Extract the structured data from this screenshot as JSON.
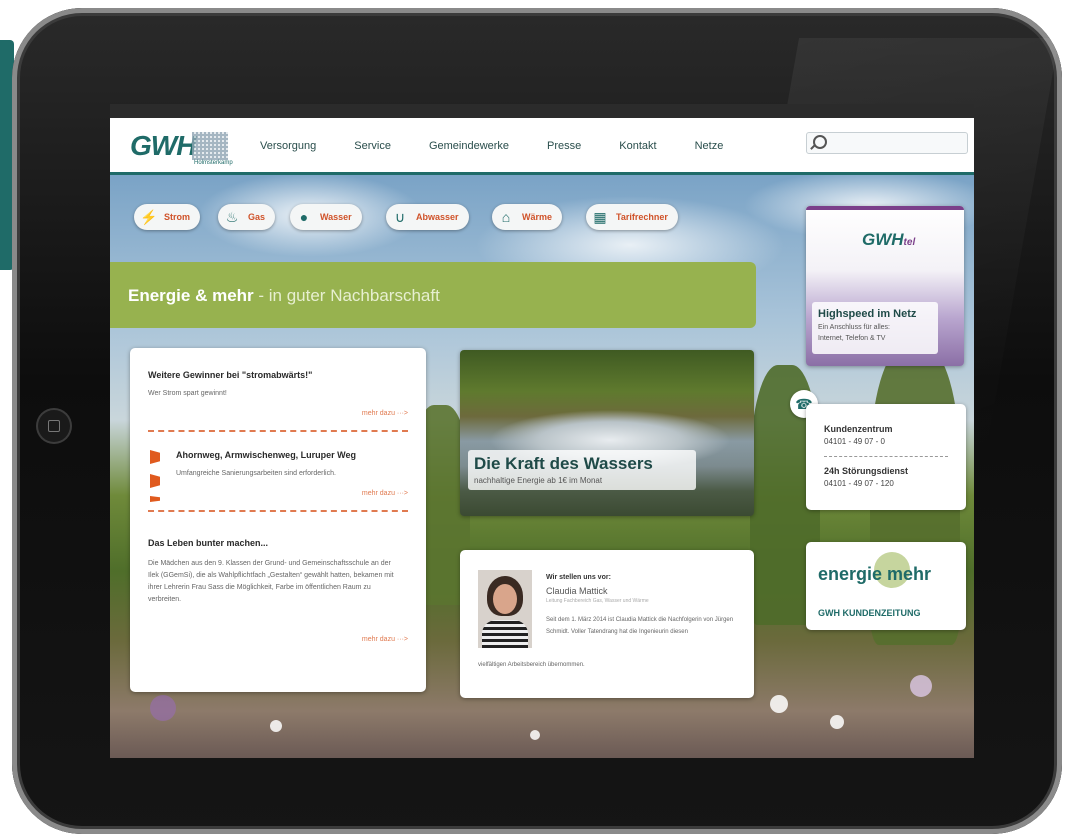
{
  "header": {
    "logo_text": "GWH",
    "logo_subtext": "Holmsterkamp",
    "nav": [
      "Versorgung",
      "Service",
      "Gemeindewerke",
      "Presse",
      "Kontakt",
      "Netze"
    ],
    "search_placeholder": ""
  },
  "categories": [
    {
      "label": "Strom",
      "icon": "plug-icon"
    },
    {
      "label": "Gas",
      "icon": "flame-icon"
    },
    {
      "label": "Wasser",
      "icon": "drop-icon"
    },
    {
      "label": "Abwasser",
      "icon": "pipe-icon"
    },
    {
      "label": "Wärme",
      "icon": "house-heat-icon"
    },
    {
      "label": "Tarifrechner",
      "icon": "calculator-icon"
    }
  ],
  "banner": {
    "title": "Energie & mehr",
    "subtitle": " - in guter Nachbarschaft"
  },
  "news": {
    "item1": {
      "title": "Weitere Gewinner bei \"stromabwärts!\"",
      "text": "Wer Strom spart gewinnt!",
      "more": "mehr dazu ···>"
    },
    "item2": {
      "title": "Ahornweg, Armwischenweg, Luruper Weg",
      "text": "Umfangreiche Sanierungsarbeiten sind erforderlich.",
      "more": "mehr dazu ···>"
    },
    "item3": {
      "title": "Das Leben bunter machen...",
      "text": "Die Mädchen aus den 9. Klassen der Grund- und Gemeinschaftsschule an der Ilek (GGemSi), die als Wahlpflichtfach „Gestalten“ gewählt hatten, bekamen mit ihrer Lehrerin Frau Sass die Möglichkeit, Farbe im öffentlichen Raum zu verbreiten.",
      "more": "mehr dazu ···>"
    }
  },
  "feature": {
    "title": "Die Kraft des Wassers",
    "subtitle": "nachhaltige Energie ab 1€ im Monat"
  },
  "staff": {
    "kicker": "Wir stellen uns vor:",
    "name": "Claudia Mattick",
    "role": "Leitung Fachbereich Gas, Wasser und Wärme",
    "text": "Seit dem 1. März 2014 ist Claudia Mattick die Nachfolgerin von Jürgen Schmidt. Voller Tatendrang hat die Ingenieurin diesen",
    "text2": "vielfältigen Arbeitsbereich übernommen."
  },
  "tel": {
    "logo": "GWH",
    "logo_suffix": "tel",
    "headline": "Highspeed im Netz",
    "line1": "Ein Anschluss für alles:",
    "line2": "Internet, Telefon & TV"
  },
  "contact": {
    "label1": "Kundenzentrum",
    "phone1": "04101 - 49 07 - 0",
    "label2": "24h Störungsdienst",
    "phone2": "04101 - 49 07 - 120"
  },
  "paper": {
    "brand": "energie mehr",
    "subtitle": "GWH KUNDENZEITUNG"
  },
  "colors": {
    "accent": "#1f6b68",
    "orange": "#d0532a",
    "green": "#97b24f",
    "purple": "#7b3f8a"
  }
}
